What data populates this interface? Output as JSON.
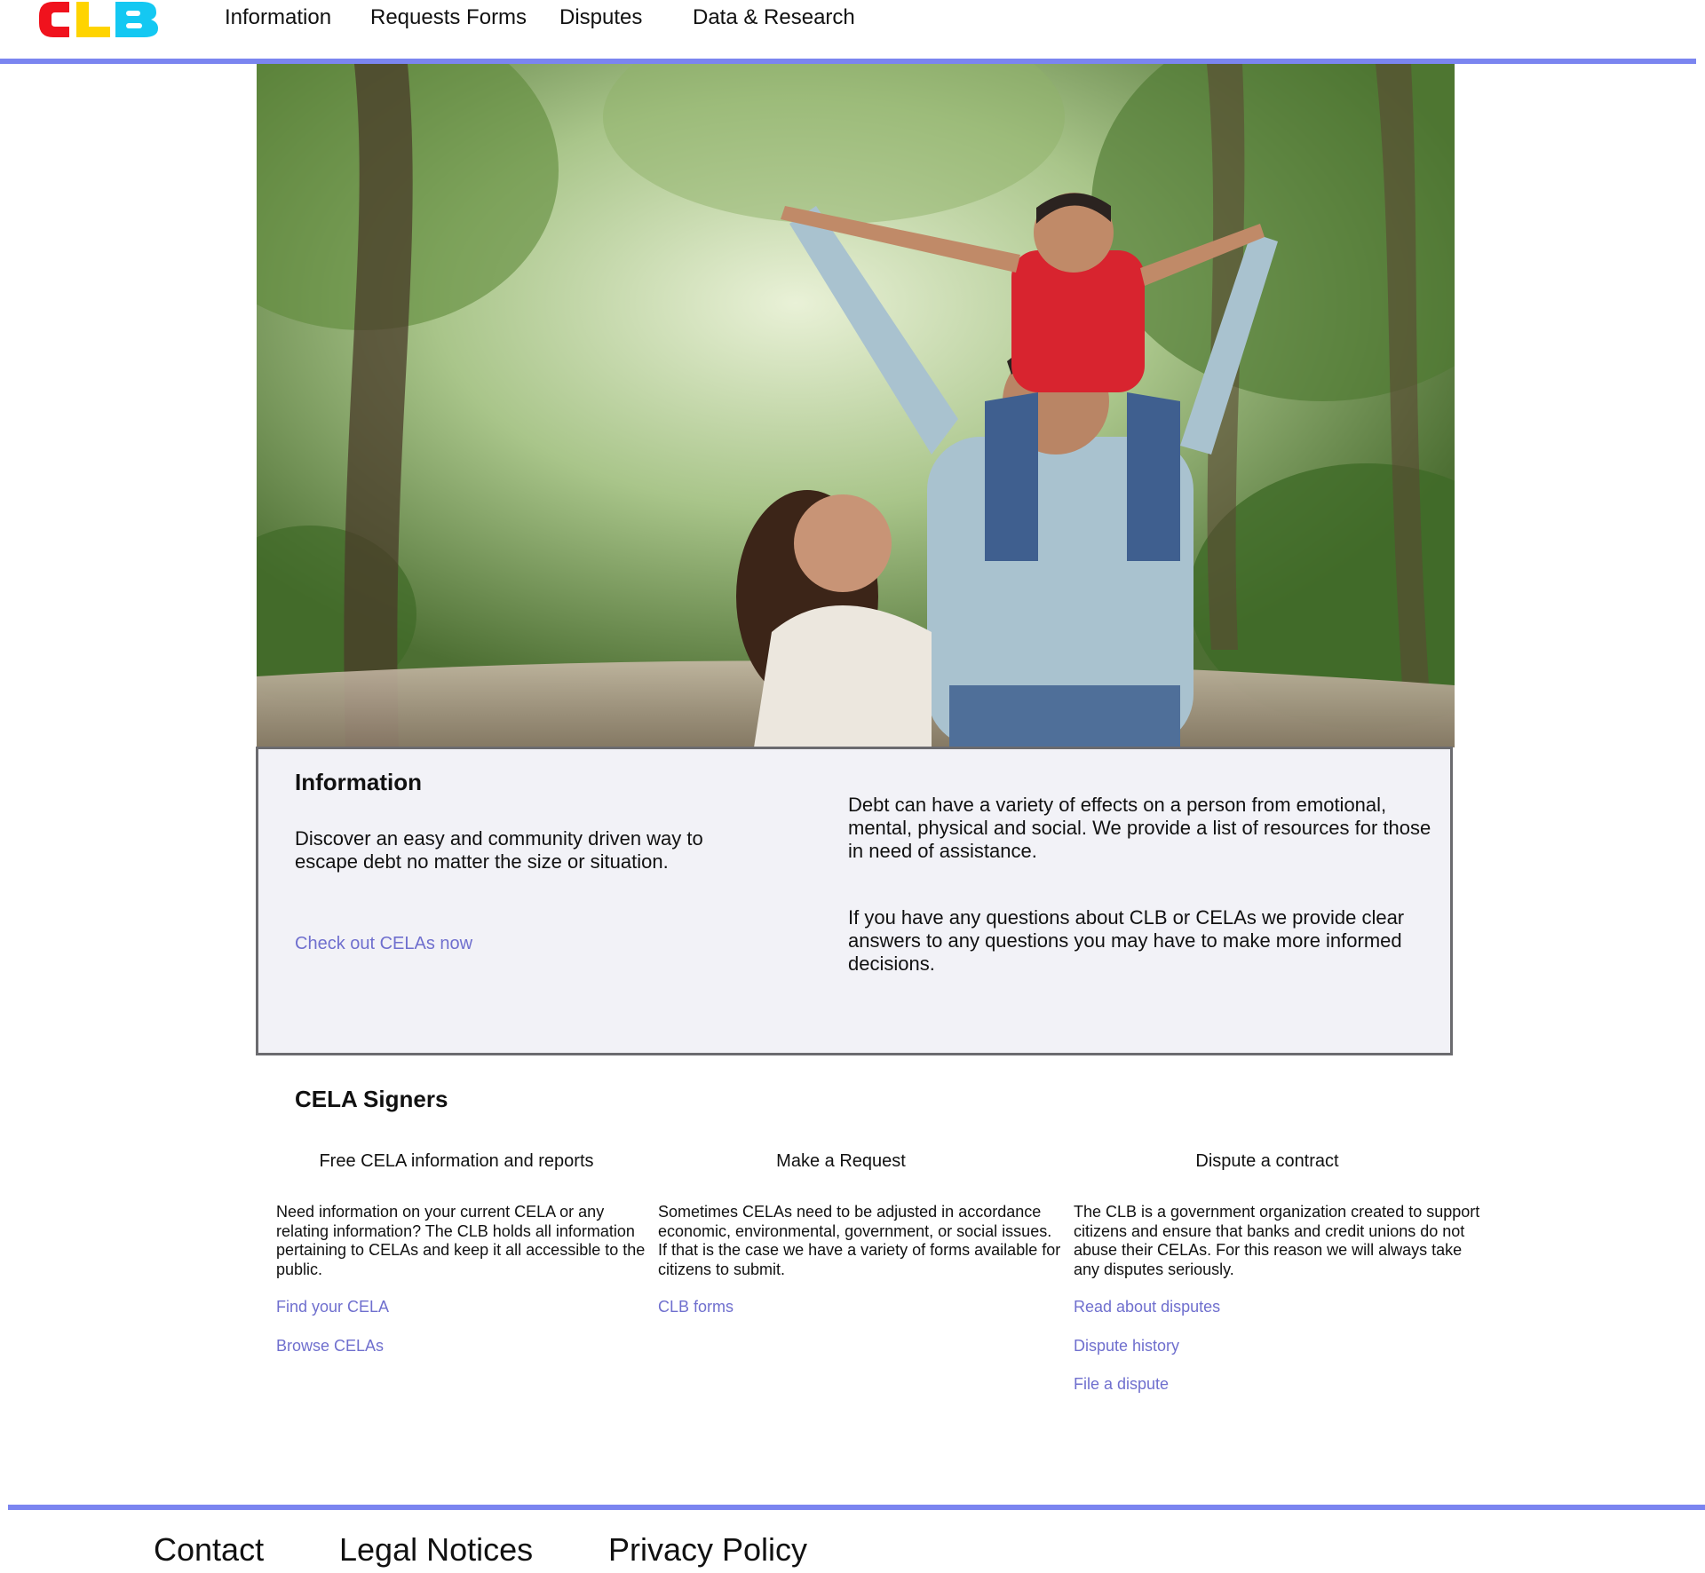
{
  "header": {
    "logo_text": "CLB",
    "nav": [
      {
        "label": "Information"
      },
      {
        "label": "Requests Forms"
      },
      {
        "label": "Disputes"
      },
      {
        "label": "Data & Research"
      }
    ]
  },
  "info": {
    "heading": "Information",
    "intro": "Discover an easy and community driven way to escape debt no matter the size or situation.",
    "cta": "Check out CELAs now",
    "paragraph1": "Debt can have a variety of effects on a person from emotional, mental, physical and social. We provide a list of resources for those in need of assistance.",
    "paragraph2": "If you have any questions about CLB or CELAs we provide clear answers to any questions you may have to make more informed decisions."
  },
  "signers": {
    "heading": "CELA Signers",
    "columns": [
      {
        "title": "Free CELA information and reports",
        "description": "Need information on your current CELA or any relating information? The CLB holds all information pertaining to CELAs and keep it all accessible to the public.",
        "links": [
          "Find your CELA",
          "Browse CELAs"
        ]
      },
      {
        "title": "Make a Request",
        "description": "Sometimes CELAs need to be adjusted in accordance economic, environmental, government, or social issues. If that is the case we have a variety of forms available for citizens to submit.",
        "links": [
          "CLB forms"
        ]
      },
      {
        "title": "Dispute a contract",
        "description": "The CLB is a government organization created to support citizens and ensure that banks and credit unions do not abuse their CELAs. For this reason we will always take any disputes seriously.",
        "links": [
          "Read about disputes",
          "Dispute history",
          "File a dispute"
        ]
      }
    ]
  },
  "footer": {
    "links": [
      "Contact",
      "Legal Notices",
      "Privacy Policy"
    ]
  },
  "colors": {
    "accent_rule": "#7b85f0",
    "link": "#6f6fce",
    "card_background": "#f2f2f7",
    "card_border": "#6b6b6f",
    "logo_red": "#f0121d",
    "logo_yellow": "#ffd400",
    "logo_cyan": "#14c8f2"
  }
}
